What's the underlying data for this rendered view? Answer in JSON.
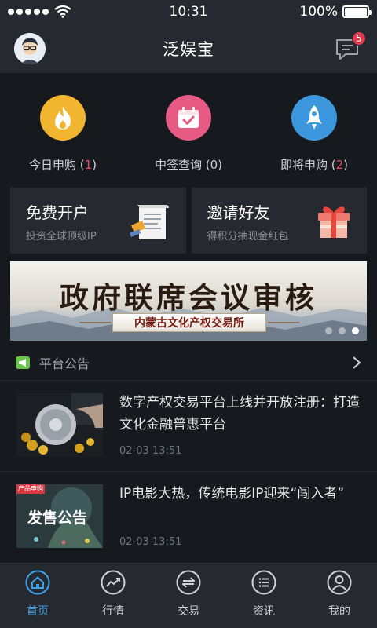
{
  "status": {
    "time": "10:31",
    "battery": "100%",
    "battery_level": 1.0
  },
  "header": {
    "title": "泛娱宝",
    "message_badge": "5"
  },
  "quick_actions": [
    {
      "label": "今日申购",
      "count": "1",
      "color": "#f2b530",
      "icon": "flame-icon"
    },
    {
      "label": "中签查询",
      "count": "0",
      "color": "#e75a84",
      "icon": "calendar-check-icon"
    },
    {
      "label": "即将申购",
      "count": "2",
      "color": "#3c97dc",
      "icon": "rocket-icon"
    }
  ],
  "promos": [
    {
      "title": "免费开户",
      "subtitle": "投资全球顶级IP",
      "icon": "document-stamp-icon"
    },
    {
      "title": "邀请好友",
      "subtitle": "得积分抽现金红包",
      "icon": "gift-icon"
    }
  ],
  "banner": {
    "title": "政府联席会议审核",
    "subtitle": "内蒙古文化产权交易所"
  },
  "notice": {
    "label": "平台公告"
  },
  "news": [
    {
      "title": "数字产权交易平台上线并开放注册：打造文化金融普惠平台",
      "time": "02-03 13:51"
    },
    {
      "title": "IP电影大热，传统电影IP迎来“闯入者”",
      "time": "02-03 13:51",
      "thumb_tag": "产品申购",
      "thumb_text": "发售公告"
    }
  ],
  "tabs": [
    {
      "label": "首页",
      "icon": "home-icon",
      "active": true
    },
    {
      "label": "行情",
      "icon": "trend-icon"
    },
    {
      "label": "交易",
      "icon": "exchange-icon"
    },
    {
      "label": "资讯",
      "icon": "list-icon"
    },
    {
      "label": "我的",
      "icon": "user-icon"
    }
  ],
  "colors": {
    "accent": "#3ea3e6",
    "badge": "#e43a4e",
    "count_red": "#e84b5e",
    "notice_green": "#6cc24a"
  }
}
